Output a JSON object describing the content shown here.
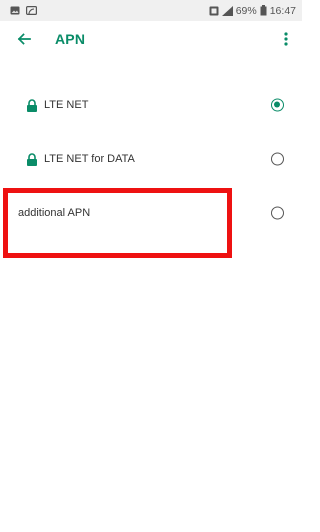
{
  "status_bar": {
    "battery_percent": "69%",
    "time": "16:47",
    "icons": [
      "image-icon",
      "cast-icon",
      "nfc-icon",
      "signal-icon",
      "battery-icon"
    ]
  },
  "app_bar": {
    "title": "APN",
    "back_icon": "back-arrow-icon",
    "more_icon": "more-vertical-icon"
  },
  "apn_list": [
    {
      "label": "LTE NET",
      "locked": true,
      "selected": true
    },
    {
      "label": "LTE NET for DATA",
      "locked": true,
      "selected": false
    },
    {
      "label": "additional APN",
      "locked": false,
      "selected": false
    }
  ],
  "colors": {
    "accent": "#0a8c68",
    "highlight": "#ee1111",
    "text": "#333333"
  }
}
